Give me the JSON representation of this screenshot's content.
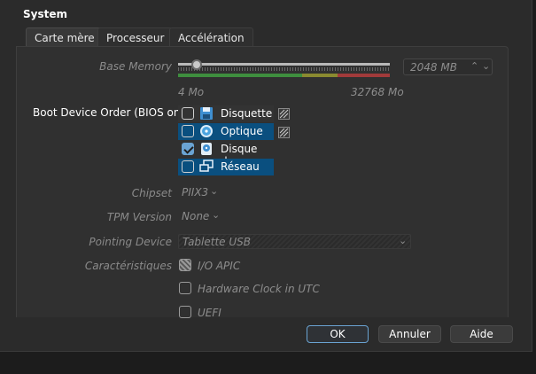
{
  "section_title": "System",
  "tabs": [
    {
      "label": "Carte mère",
      "active": true
    },
    {
      "label": "Processeur",
      "active": false
    },
    {
      "label": "Accélération",
      "active": false
    }
  ],
  "memory": {
    "label": "Base Memory",
    "value": "2048 MB",
    "min_label": "4 Mo",
    "max_label": "32768 Mo",
    "level_fraction": 0.0624
  },
  "boot": {
    "label": "Boot Device Order (BIOS only)",
    "items": [
      {
        "label": "Disquette",
        "checked": false,
        "icon": "floppy-icon",
        "selected": false
      },
      {
        "label": "Optique",
        "checked": false,
        "icon": "optical-disc-icon",
        "selected": true
      },
      {
        "label": "Disque dur",
        "checked": true,
        "icon": "hard-disk-icon",
        "selected": false
      },
      {
        "label": "Réseau",
        "checked": false,
        "icon": "network-icon",
        "selected": true
      }
    ]
  },
  "chipset": {
    "label": "Chipset",
    "value": "PIIX3"
  },
  "tpm": {
    "label": "TPM Version",
    "value": "None"
  },
  "pointing": {
    "label": "Pointing Device",
    "value": "Tablette USB"
  },
  "features": {
    "label": "Caractéristiques",
    "options": [
      {
        "label": "I/O APIC",
        "checked": true
      },
      {
        "label": "Hardware Clock in UTC",
        "checked": false
      },
      {
        "label": "UEFI",
        "checked": false
      }
    ]
  },
  "buttons": {
    "ok": "OK",
    "cancel": "Annuler",
    "help": "Aide"
  },
  "colors": {
    "accent": "#6aa3d2",
    "selection": "#0a4f7f",
    "range_green": "#3e8e3e",
    "range_red": "#a13a3a"
  }
}
